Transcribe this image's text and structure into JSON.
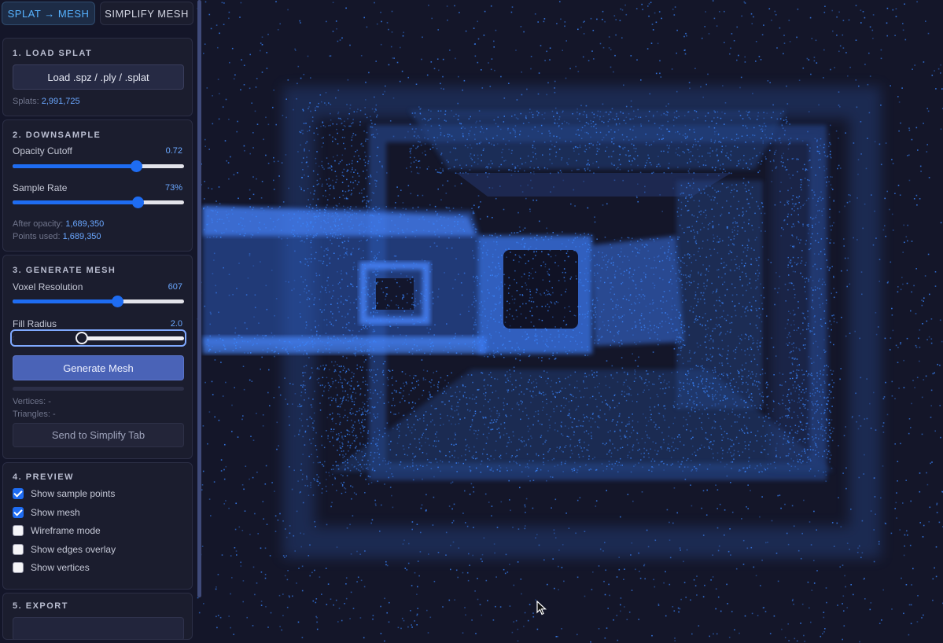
{
  "tabs": [
    {
      "label": "SPLAT → MESH",
      "active": true
    },
    {
      "label": "SIMPLIFY MESH",
      "active": false
    }
  ],
  "load": {
    "title": "1. LOAD SPLAT",
    "button": "Load .spz / .ply / .splat",
    "splats_label": "Splats:",
    "splats_value": "2,991,725"
  },
  "downsample": {
    "title": "2. DOWNSAMPLE",
    "opacity_label": "Opacity Cutoff",
    "opacity_value": "0.72",
    "opacity_fraction": 0.72,
    "sample_label": "Sample Rate",
    "sample_value": "73%",
    "sample_fraction": 0.73,
    "after_opacity_label": "After opacity:",
    "after_opacity_value": "1,689,350",
    "points_used_label": "Points used:",
    "points_used_value": "1,689,350"
  },
  "mesh": {
    "title": "3. GENERATE MESH",
    "voxel_label": "Voxel Resolution",
    "voxel_value": "607",
    "voxel_fraction": 0.61,
    "fill_label": "Fill Radius",
    "fill_value": "2.0",
    "fill_fraction": 0.4,
    "generate_button": "Generate Mesh",
    "vertices_label": "Vertices:",
    "vertices_value": "-",
    "triangles_label": "Triangles:",
    "triangles_value": "-",
    "send_button": "Send to Simplify Tab"
  },
  "preview": {
    "title": "4. PREVIEW",
    "options": [
      {
        "label": "Show sample points",
        "checked": true
      },
      {
        "label": "Show mesh",
        "checked": true
      },
      {
        "label": "Wireframe mode",
        "checked": false
      },
      {
        "label": "Show edges overlay",
        "checked": false
      },
      {
        "label": "Show vertices",
        "checked": false
      }
    ]
  },
  "export": {
    "title": "5. EXPORT"
  },
  "colors": {
    "accent": "#1e6cf2",
    "point_color": "#3a86ff",
    "background": "#131528"
  }
}
